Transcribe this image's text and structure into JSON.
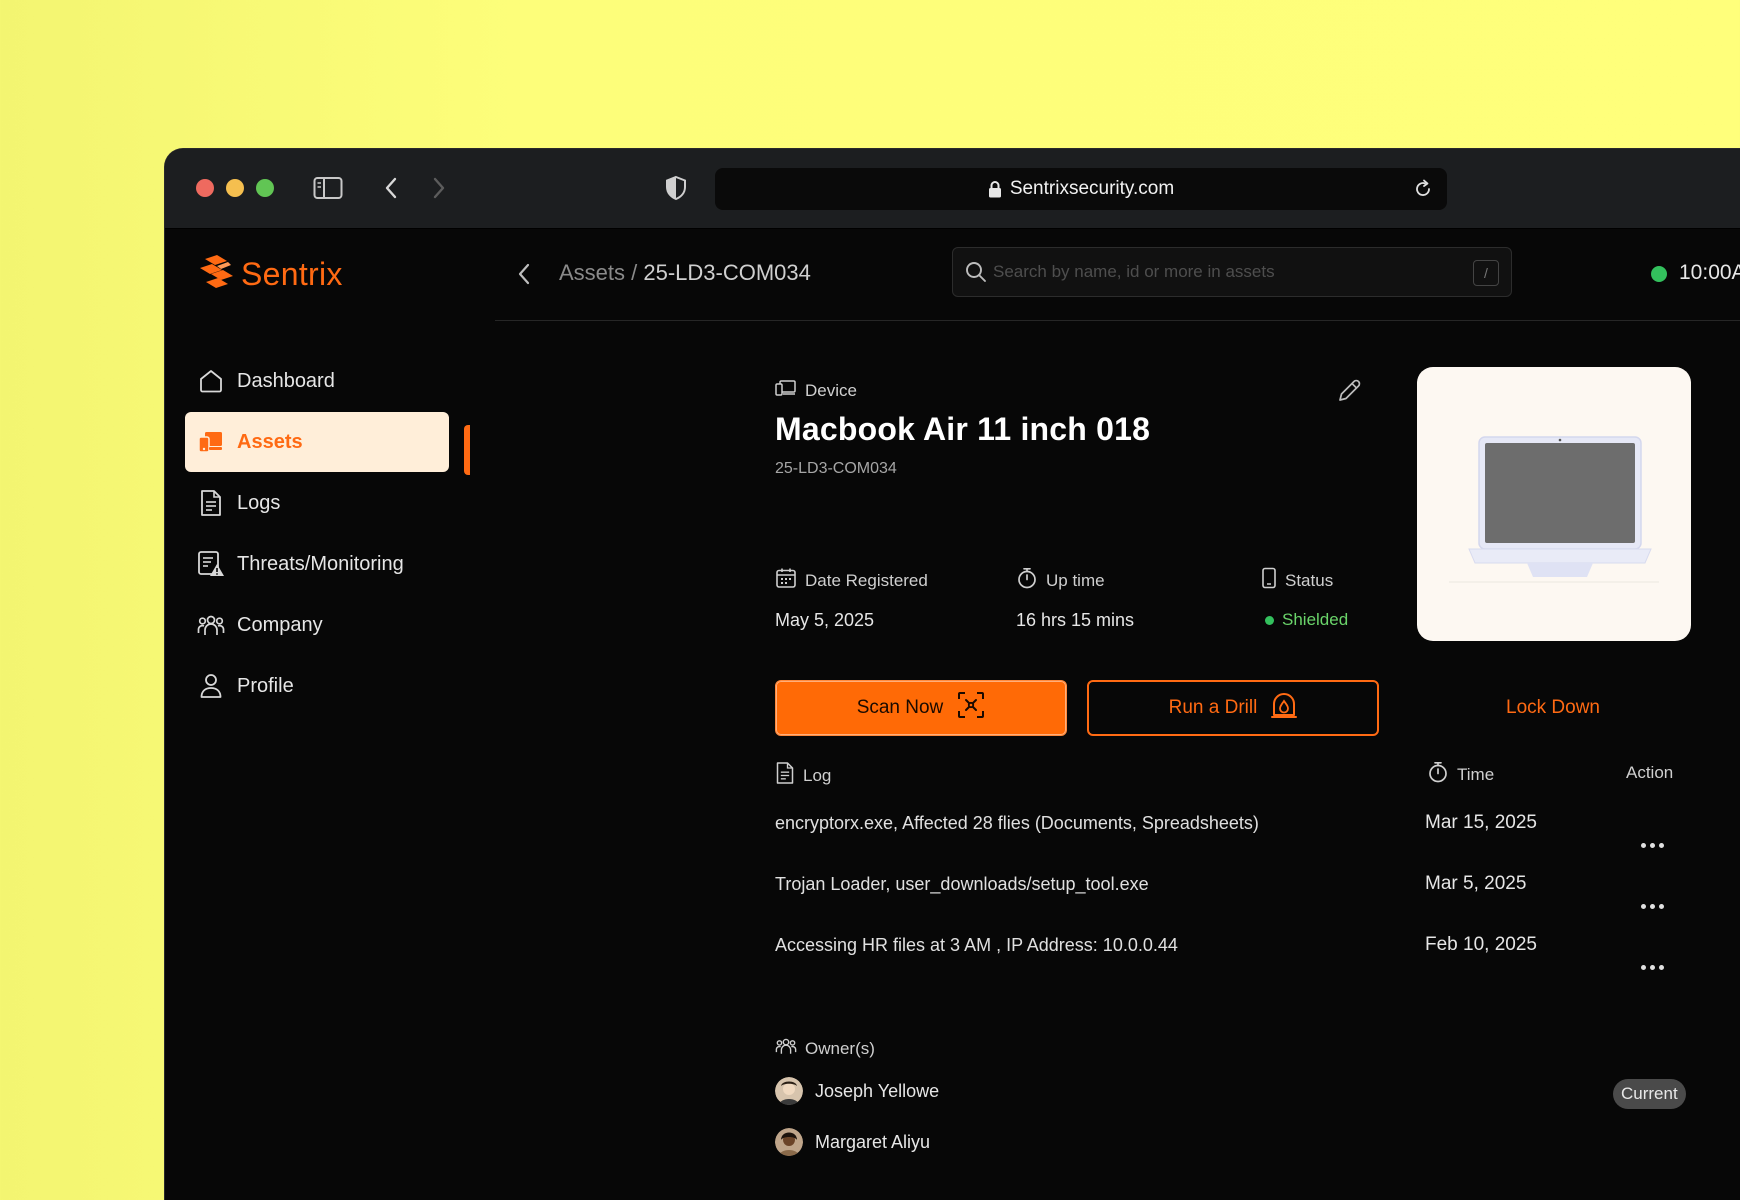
{
  "browser": {
    "url": "Sentrixsecurity.com"
  },
  "sidebar": {
    "brand": "Sentrix",
    "items": [
      {
        "label": "Dashboard",
        "icon": "home-icon"
      },
      {
        "label": "Assets",
        "icon": "assets-icon",
        "active": true
      },
      {
        "label": "Logs",
        "icon": "document-icon"
      },
      {
        "label": "Threats/Monitoring",
        "icon": "threat-icon"
      },
      {
        "label": "Company",
        "icon": "team-icon"
      },
      {
        "label": "Profile",
        "icon": "user-icon"
      }
    ]
  },
  "header": {
    "breadcrumb_parent": "Assets",
    "breadcrumb_separator": " / ",
    "breadcrumb_current": "25-LD3-COM034",
    "search_placeholder": "Search by name, id or more in assets",
    "search_shortcut": "/",
    "clock": "10:00A"
  },
  "device": {
    "type_label": "Device",
    "name": "Macbook Air 11 inch 018",
    "id": "25-LD3-COM034",
    "stats": {
      "date_label": "Date Registered",
      "date_value": "May 5, 2025",
      "uptime_label": "Up time",
      "uptime_value": "16 hrs 15 mins",
      "status_label": "Status",
      "status_value": "Shielded"
    }
  },
  "actions": {
    "scan": "Scan Now",
    "drill": "Run a Drill",
    "lockdown": "Lock Down"
  },
  "log_table": {
    "col_log": "Log",
    "col_time": "Time",
    "col_action": "Action",
    "rows": [
      {
        "log": "encryptorx.exe,  Affected 28 flies (Documents, Spreadsheets)",
        "time": "Mar 15, 2025"
      },
      {
        "log": "Trojan Loader,  user_downloads/setup_tool.exe",
        "time": "Mar 5, 2025"
      },
      {
        "log": "Accessing HR files at 3 AM , IP Address: 10.0.0.44",
        "time": "Feb 10, 2025"
      }
    ]
  },
  "owners": {
    "label": "Owner(s)",
    "list": [
      {
        "name": "Joseph Yellowe",
        "badge": "Current"
      },
      {
        "name": "Margaret Aliyu"
      }
    ]
  },
  "colors": {
    "accent": "#ff6a13",
    "status_green": "#33c05d",
    "background": "#070707"
  }
}
